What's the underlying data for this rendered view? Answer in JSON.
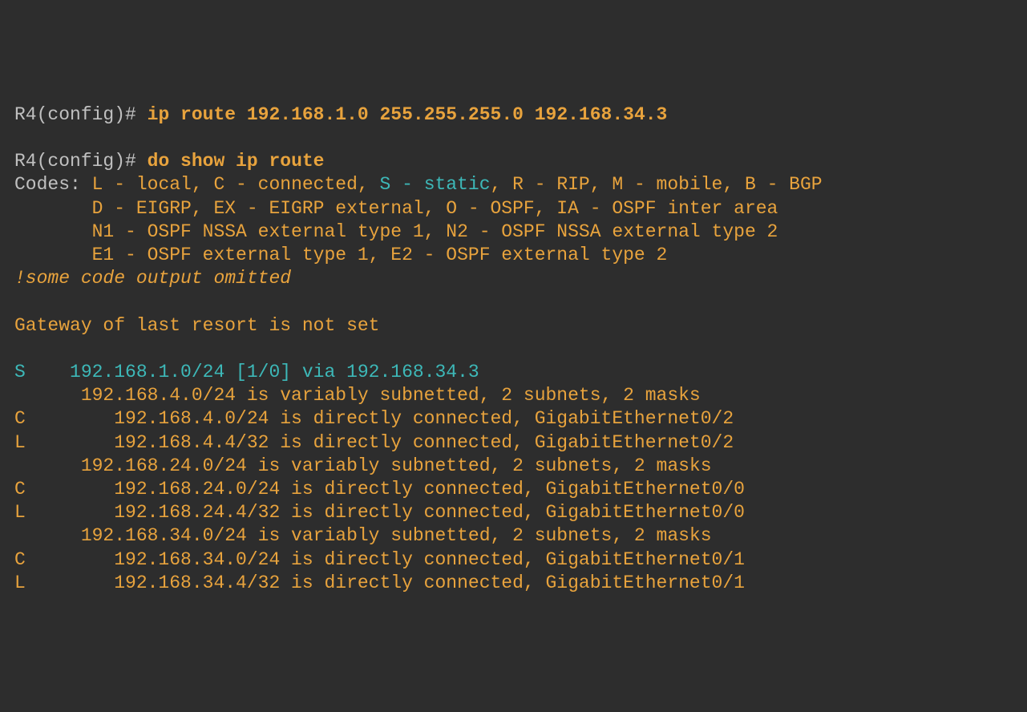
{
  "terminal": {
    "prompt1": "R4(config)# ",
    "command1": "ip route 192.168.1.0 255.255.255.0 192.168.34.3",
    "prompt2": "R4(config)# ",
    "command2": "do show ip route",
    "codes_prefix": "Codes: ",
    "codes_line1_a": "L - local, C - connected, ",
    "codes_line1_s": "S - static",
    "codes_line1_b": ", R - RIP, M - mobile, B - BGP",
    "codes_line2": "       D - EIGRP, EX - EIGRP external, O - OSPF, IA - OSPF inter area",
    "codes_line3": "       N1 - OSPF NSSA external type 1, N2 - OSPF NSSA external type 2",
    "codes_line4": "       E1 - OSPF external type 1, E2 - OSPF external type 2",
    "omitted": "!some code output omitted",
    "gateway": "Gateway of last resort is not set",
    "route_s_code": "S",
    "route_s_line": "    192.168.1.0/24 [1/0] via 192.168.34.3",
    "route_4_header": "      192.168.4.0/24 is variably subnetted, 2 subnets, 2 masks",
    "route_4_c": "C        192.168.4.0/24 is directly connected, GigabitEthernet0/2",
    "route_4_l": "L        192.168.4.4/32 is directly connected, GigabitEthernet0/2",
    "route_24_header": "      192.168.24.0/24 is variably subnetted, 2 subnets, 2 masks",
    "route_24_c": "C        192.168.24.0/24 is directly connected, GigabitEthernet0/0",
    "route_24_l": "L        192.168.24.4/32 is directly connected, GigabitEthernet0/0",
    "route_34_header": "      192.168.34.0/24 is variably subnetted, 2 subnets, 2 masks",
    "route_34_c": "C        192.168.34.0/24 is directly connected, GigabitEthernet0/1",
    "route_34_l": "L        192.168.34.4/32 is directly connected, GigabitEthernet0/1"
  }
}
